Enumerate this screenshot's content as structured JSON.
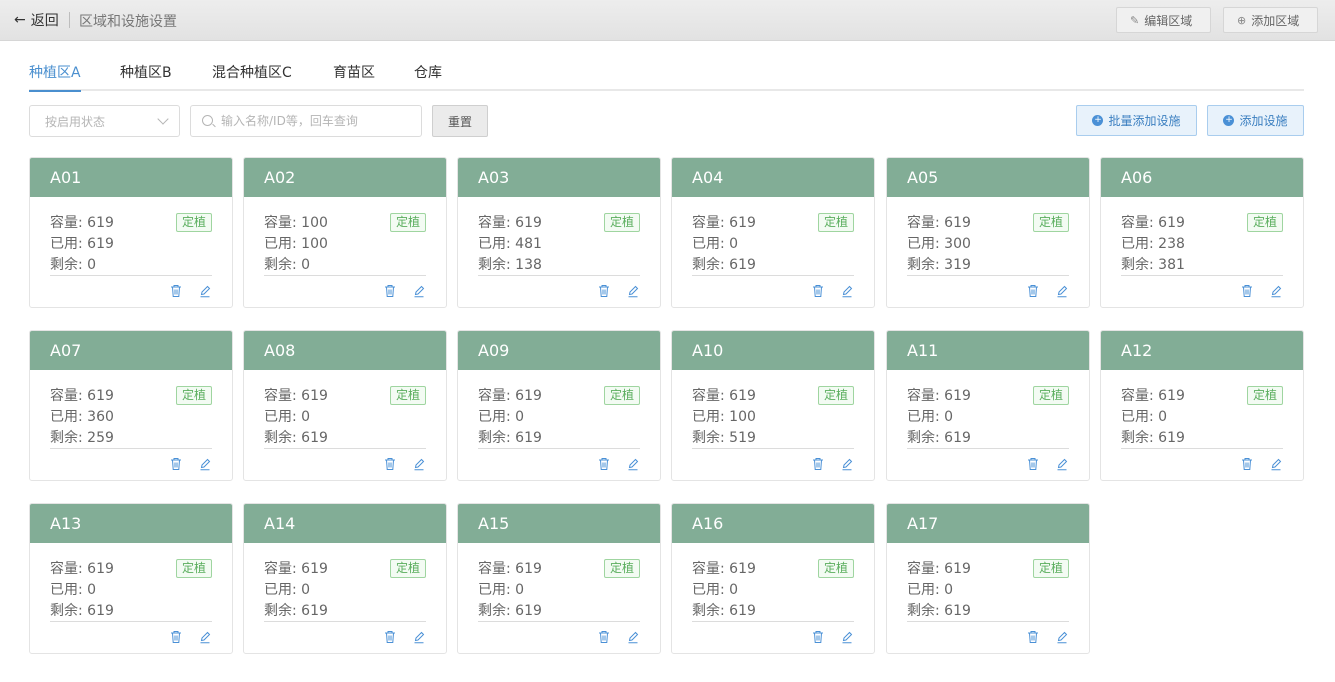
{
  "header": {
    "back_label": "返回",
    "title": "区域和设施设置",
    "edit_area_label": "编辑区域",
    "add_area_label": "添加区域"
  },
  "tabs": [
    "种植区A",
    "种植区B",
    "混合种植区C",
    "育苗区",
    "仓库"
  ],
  "filters": {
    "status_placeholder": "按启用状态",
    "search_placeholder": "输入名称/ID等，回车查询",
    "reset_label": "重置",
    "batch_add_label": "批量添加设施",
    "add_facility_label": "添加设施"
  },
  "labels": {
    "capacity": "容量",
    "used": "已用",
    "remain": "剩余"
  },
  "colors": {
    "card_header": "#82ad96",
    "accent": "#4a8fcf",
    "tag_green": "#5aae5d"
  },
  "cards": [
    {
      "name": "A01",
      "capacity": "619",
      "used": "619",
      "remain": "0",
      "tag": "定植"
    },
    {
      "name": "A02",
      "capacity": "100",
      "used": "100",
      "remain": "0",
      "tag": "定植"
    },
    {
      "name": "A03",
      "capacity": "619",
      "used": "481",
      "remain": "138",
      "tag": "定植"
    },
    {
      "name": "A04",
      "capacity": "619",
      "used": "0",
      "remain": "619",
      "tag": "定植"
    },
    {
      "name": "A05",
      "capacity": "619",
      "used": "300",
      "remain": "319",
      "tag": "定植"
    },
    {
      "name": "A06",
      "capacity": "619",
      "used": "238",
      "remain": "381",
      "tag": "定植"
    },
    {
      "name": "A07",
      "capacity": "619",
      "used": "360",
      "remain": "259",
      "tag": "定植"
    },
    {
      "name": "A08",
      "capacity": "619",
      "used": "0",
      "remain": "619",
      "tag": "定植"
    },
    {
      "name": "A09",
      "capacity": "619",
      "used": "0",
      "remain": "619",
      "tag": "定植"
    },
    {
      "name": "A10",
      "capacity": "619",
      "used": "100",
      "remain": "519",
      "tag": "定植"
    },
    {
      "name": "A11",
      "capacity": "619",
      "used": "0",
      "remain": "619",
      "tag": "定植"
    },
    {
      "name": "A12",
      "capacity": "619",
      "used": "0",
      "remain": "619",
      "tag": "定植"
    },
    {
      "name": "A13",
      "capacity": "619",
      "used": "0",
      "remain": "619",
      "tag": "定植"
    },
    {
      "name": "A14",
      "capacity": "619",
      "used": "0",
      "remain": "619",
      "tag": "定植"
    },
    {
      "name": "A15",
      "capacity": "619",
      "used": "0",
      "remain": "619",
      "tag": "定植"
    },
    {
      "name": "A16",
      "capacity": "619",
      "used": "0",
      "remain": "619",
      "tag": "定植"
    },
    {
      "name": "A17",
      "capacity": "619",
      "used": "0",
      "remain": "619",
      "tag": "定植"
    }
  ]
}
